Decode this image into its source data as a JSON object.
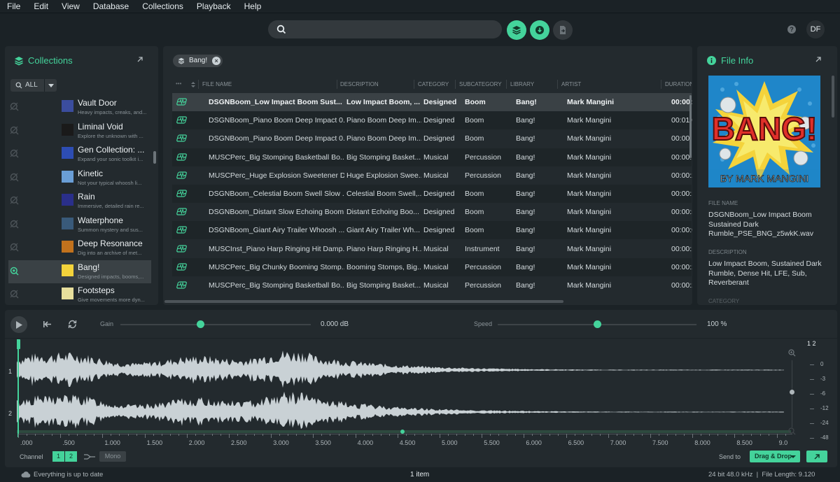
{
  "menu": [
    "File",
    "Edit",
    "View",
    "Database",
    "Collections",
    "Playback",
    "Help"
  ],
  "topbar": {
    "search_placeholder": "",
    "user_initials": "DF",
    "help_label": "?"
  },
  "collections": {
    "title": "Collections",
    "filter_label": "ALL",
    "items": [
      {
        "name": "Vault Door",
        "desc": "Heavy impacts, creaks, and..."
      },
      {
        "name": "Liminal Void",
        "desc": "Explore the unknown with ..."
      },
      {
        "name": "Gen Collection: ...",
        "desc": "Expand your sonic toolkit i..."
      },
      {
        "name": "Kinetic",
        "desc": "Not your typical whoosh li..."
      },
      {
        "name": "Rain",
        "desc": "Immersive, detailed rain re..."
      },
      {
        "name": "Waterphone",
        "desc": "Summon mystery and sus..."
      },
      {
        "name": "Deep Resonance",
        "desc": "Dig into an archive of met..."
      },
      {
        "name": "Bang!",
        "desc": "Designed impacts, booms,..."
      },
      {
        "name": "Footsteps",
        "desc": "Give movements more dyn..."
      }
    ]
  },
  "filter_chip": "Bang!",
  "table": {
    "columns": [
      "FILE NAME",
      "DESCRIPTION",
      "CATEGORY",
      "SUBCATEGORY",
      "LIBRARY",
      "ARTIST",
      "DURATION"
    ],
    "rows": [
      [
        "DSGNBoom_Low Impact Boom Sust...",
        "Low Impact Boom, ...",
        "Designed",
        "Boom",
        "Bang!",
        "Mark Mangini",
        "00:00:09"
      ],
      [
        "DSGNBoom_Piano Boom Deep Impact 0...",
        "Piano Boom Deep Im...",
        "Designed",
        "Boom",
        "Bang!",
        "Mark Mangini",
        "00:01:04"
      ],
      [
        "DSGNBoom_Piano Boom Deep Impact 0...",
        "Piano Boom Deep Im...",
        "Designed",
        "Boom",
        "Bang!",
        "Mark Mangini",
        "00:00:15"
      ],
      [
        "MUSCPerc_Big Stomping Basketball Bo...",
        "Big Stomping Basket...",
        "Musical",
        "Percussion",
        "Bang!",
        "Mark Mangini",
        "00:00:18"
      ],
      [
        "MUSCPerc_Huge Explosion Sweetener D...",
        "Huge Explosion Swee...",
        "Musical",
        "Percussion",
        "Bang!",
        "Mark Mangini",
        "00:00:27"
      ],
      [
        "DSGNBoom_Celestial Boom Swell Slow ...",
        "Celestial Boom Swell,...",
        "Designed",
        "Boom",
        "Bang!",
        "Mark Mangini",
        "00:00:11"
      ],
      [
        "DSGNBoom_Distant Slow Echoing Boom...",
        "Distant Echoing Boo...",
        "Designed",
        "Boom",
        "Bang!",
        "Mark Mangini",
        "00:00:56"
      ],
      [
        "DSGNBoom_Giant Airy Trailer Whoosh ...",
        "Giant Airy Trailer Wh...",
        "Designed",
        "Boom",
        "Bang!",
        "Mark Mangini",
        "00:00:04"
      ],
      [
        "MUSCInst_Piano Harp Ringing Hit Damp...",
        "Piano Harp Ringing H...",
        "Musical",
        "Instrument",
        "Bang!",
        "Mark Mangini",
        "00:00:12"
      ],
      [
        "MUSCPerc_Big Chunky Booming Stomp...",
        "Booming Stomps, Big...",
        "Musical",
        "Percussion",
        "Bang!",
        "Mark Mangini",
        "00:00:21"
      ],
      [
        "MUSCPerc_Big Stomping Basketball Bo...",
        "Big Stomping Basket...",
        "Musical",
        "Percussion",
        "Bang!",
        "Mark Mangini",
        "00:00:21"
      ]
    ]
  },
  "file_info": {
    "title": "File Info",
    "cover_title": "BANG!",
    "cover_subtitle": "BY MARK MANGINI",
    "file_name_label": "FILE NAME",
    "file_name": "DSGNBoom_Low Impact Boom Sustained Dark Rumble_PSE_BNG_z5wkK.wav",
    "description_label": "DESCRIPTION",
    "description": "Low Impact Boom, Sustained Dark Rumble, Dense Hit, LFE, Sub, Reverberant",
    "category_label": "CATEGORY"
  },
  "player": {
    "gain_label": "Gain",
    "gain_value": "0.000 dB",
    "gain_level": 0.42,
    "speed_label": "Speed",
    "speed_value": "100 %",
    "speed_level": 0.5,
    "channel_label": "Channel",
    "channels": [
      "1",
      "2"
    ],
    "mono_label": "Mono",
    "send_to_label": "Send to",
    "send_target": "Drag & Drop",
    "channel_rows": [
      "1",
      "2"
    ],
    "meter_channels": [
      "1",
      "2"
    ],
    "db_scale": [
      "0",
      "-3",
      "-6",
      "-12",
      "-24",
      "-48",
      "-∞"
    ],
    "timeline": [
      ".000",
      ".500",
      "1.000",
      "1.500",
      "2.000",
      "2.500",
      "3.000",
      "3.500",
      "4.000",
      "4.500",
      "5.000",
      "5.500",
      "6.000",
      "6.500",
      "7.000",
      "7.500",
      "8.000",
      "8.500",
      "9.0"
    ]
  },
  "status": {
    "left": "Everything is up to date",
    "center": "1 item",
    "right": "24 bit 48.0 kHz  |  File Length: 9.120"
  },
  "colors": {
    "accent": "#44d39b",
    "background": "#1b2226",
    "panel": "#232a2e"
  }
}
